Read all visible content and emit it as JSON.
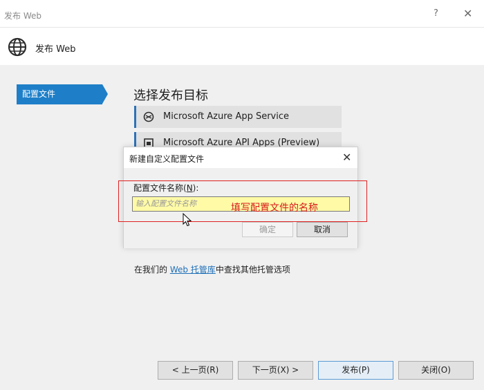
{
  "window": {
    "title": "发布 Web",
    "help_label": "?",
    "close_label": "✕"
  },
  "header": {
    "title": "发布 Web",
    "icon": "globe-icon"
  },
  "sidebar": {
    "items": [
      {
        "label": "配置文件",
        "selected": true
      }
    ]
  },
  "main": {
    "heading": "选择发布目标",
    "targets": [
      {
        "label": "Microsoft Azure App Service",
        "icon": "azure-app-service-icon"
      },
      {
        "label": "Microsoft Azure API Apps (Preview)",
        "icon": "azure-api-apps-icon"
      }
    ],
    "hosting": {
      "prefix": "在我们的 ",
      "link": "Web 托管库",
      "suffix": "中查找其他托管选项"
    }
  },
  "footer": {
    "prev": "< 上一页(R)",
    "next": "下一页(X) >",
    "publish": "发布(P)",
    "close": "关闭(O)"
  },
  "dialog": {
    "title": "新建自定义配置文件",
    "close_label": "✕",
    "field_label_prefix": "配置文件名称(",
    "field_label_key": "N",
    "field_label_suffix": "):",
    "input_placeholder": "输入配置文件名称",
    "ok": "确定",
    "cancel": "取消"
  },
  "annotation": {
    "text": "填写配置文件的名称",
    "color": "#d81b1b"
  },
  "colors": {
    "accent": "#1e7fc8",
    "input_highlight": "#fefaa6"
  }
}
